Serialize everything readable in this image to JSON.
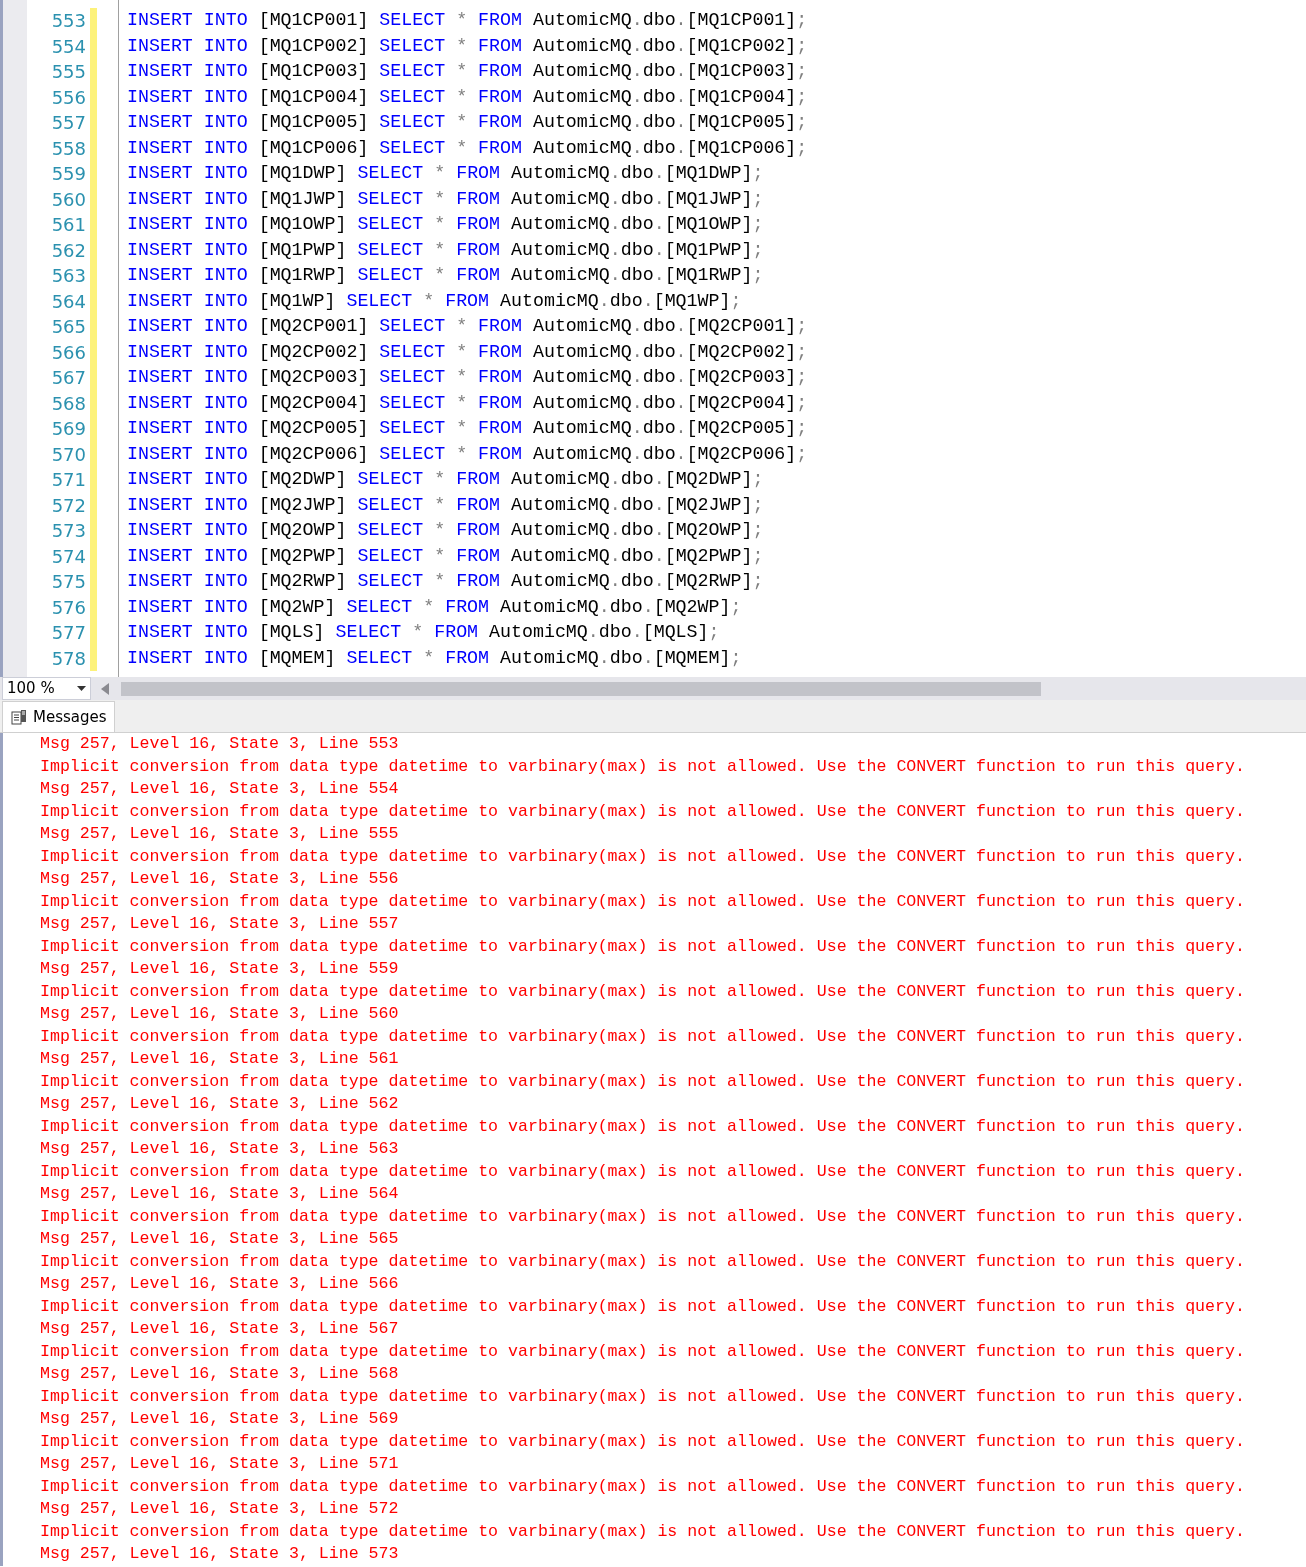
{
  "editor": {
    "lines": [
      {
        "number": "553",
        "modified": true,
        "tokens": [
          {
            "kind": "keyword",
            "text": "INSERT INTO "
          },
          {
            "kind": "name",
            "text": "[MQ1CP001] "
          },
          {
            "kind": "keyword",
            "text": "SELECT "
          },
          {
            "kind": "operator",
            "text": "* "
          },
          {
            "kind": "keyword",
            "text": "FROM "
          },
          {
            "kind": "name",
            "text": "AutomicMQ"
          },
          {
            "kind": "operator",
            "text": "."
          },
          {
            "kind": "name",
            "text": "dbo"
          },
          {
            "kind": "operator",
            "text": "."
          },
          {
            "kind": "name",
            "text": "[MQ1CP001]"
          },
          {
            "kind": "operator",
            "text": ";"
          }
        ]
      },
      {
        "number": "554",
        "modified": true,
        "tokens": [
          {
            "kind": "keyword",
            "text": "INSERT INTO "
          },
          {
            "kind": "name",
            "text": "[MQ1CP002] "
          },
          {
            "kind": "keyword",
            "text": "SELECT "
          },
          {
            "kind": "operator",
            "text": "* "
          },
          {
            "kind": "keyword",
            "text": "FROM "
          },
          {
            "kind": "name",
            "text": "AutomicMQ"
          },
          {
            "kind": "operator",
            "text": "."
          },
          {
            "kind": "name",
            "text": "dbo"
          },
          {
            "kind": "operator",
            "text": "."
          },
          {
            "kind": "name",
            "text": "[MQ1CP002]"
          },
          {
            "kind": "operator",
            "text": ";"
          }
        ]
      },
      {
        "number": "555",
        "modified": true,
        "tokens": [
          {
            "kind": "keyword",
            "text": "INSERT INTO "
          },
          {
            "kind": "name",
            "text": "[MQ1CP003] "
          },
          {
            "kind": "keyword",
            "text": "SELECT "
          },
          {
            "kind": "operator",
            "text": "* "
          },
          {
            "kind": "keyword",
            "text": "FROM "
          },
          {
            "kind": "name",
            "text": "AutomicMQ"
          },
          {
            "kind": "operator",
            "text": "."
          },
          {
            "kind": "name",
            "text": "dbo"
          },
          {
            "kind": "operator",
            "text": "."
          },
          {
            "kind": "name",
            "text": "[MQ1CP003]"
          },
          {
            "kind": "operator",
            "text": ";"
          }
        ]
      },
      {
        "number": "556",
        "modified": true,
        "tokens": [
          {
            "kind": "keyword",
            "text": "INSERT INTO "
          },
          {
            "kind": "name",
            "text": "[MQ1CP004] "
          },
          {
            "kind": "keyword",
            "text": "SELECT "
          },
          {
            "kind": "operator",
            "text": "* "
          },
          {
            "kind": "keyword",
            "text": "FROM "
          },
          {
            "kind": "name",
            "text": "AutomicMQ"
          },
          {
            "kind": "operator",
            "text": "."
          },
          {
            "kind": "name",
            "text": "dbo"
          },
          {
            "kind": "operator",
            "text": "."
          },
          {
            "kind": "name",
            "text": "[MQ1CP004]"
          },
          {
            "kind": "operator",
            "text": ";"
          }
        ]
      },
      {
        "number": "557",
        "modified": true,
        "tokens": [
          {
            "kind": "keyword",
            "text": "INSERT INTO "
          },
          {
            "kind": "name",
            "text": "[MQ1CP005] "
          },
          {
            "kind": "keyword",
            "text": "SELECT "
          },
          {
            "kind": "operator",
            "text": "* "
          },
          {
            "kind": "keyword",
            "text": "FROM "
          },
          {
            "kind": "name",
            "text": "AutomicMQ"
          },
          {
            "kind": "operator",
            "text": "."
          },
          {
            "kind": "name",
            "text": "dbo"
          },
          {
            "kind": "operator",
            "text": "."
          },
          {
            "kind": "name",
            "text": "[MQ1CP005]"
          },
          {
            "kind": "operator",
            "text": ";"
          }
        ]
      },
      {
        "number": "558",
        "modified": true,
        "tokens": [
          {
            "kind": "keyword",
            "text": "INSERT INTO "
          },
          {
            "kind": "name",
            "text": "[MQ1CP006] "
          },
          {
            "kind": "keyword",
            "text": "SELECT "
          },
          {
            "kind": "operator",
            "text": "* "
          },
          {
            "kind": "keyword",
            "text": "FROM "
          },
          {
            "kind": "name",
            "text": "AutomicMQ"
          },
          {
            "kind": "operator",
            "text": "."
          },
          {
            "kind": "name",
            "text": "dbo"
          },
          {
            "kind": "operator",
            "text": "."
          },
          {
            "kind": "name",
            "text": "[MQ1CP006]"
          },
          {
            "kind": "operator",
            "text": ";"
          }
        ]
      },
      {
        "number": "559",
        "modified": true,
        "tokens": [
          {
            "kind": "keyword",
            "text": "INSERT INTO "
          },
          {
            "kind": "name",
            "text": "[MQ1DWP] "
          },
          {
            "kind": "keyword",
            "text": "SELECT "
          },
          {
            "kind": "operator",
            "text": "* "
          },
          {
            "kind": "keyword",
            "text": "FROM "
          },
          {
            "kind": "name",
            "text": "AutomicMQ"
          },
          {
            "kind": "operator",
            "text": "."
          },
          {
            "kind": "name",
            "text": "dbo"
          },
          {
            "kind": "operator",
            "text": "."
          },
          {
            "kind": "name",
            "text": "[MQ1DWP]"
          },
          {
            "kind": "operator",
            "text": ";"
          }
        ]
      },
      {
        "number": "560",
        "modified": true,
        "tokens": [
          {
            "kind": "keyword",
            "text": "INSERT INTO "
          },
          {
            "kind": "name",
            "text": "[MQ1JWP] "
          },
          {
            "kind": "keyword",
            "text": "SELECT "
          },
          {
            "kind": "operator",
            "text": "* "
          },
          {
            "kind": "keyword",
            "text": "FROM "
          },
          {
            "kind": "name",
            "text": "AutomicMQ"
          },
          {
            "kind": "operator",
            "text": "."
          },
          {
            "kind": "name",
            "text": "dbo"
          },
          {
            "kind": "operator",
            "text": "."
          },
          {
            "kind": "name",
            "text": "[MQ1JWP]"
          },
          {
            "kind": "operator",
            "text": ";"
          }
        ]
      },
      {
        "number": "561",
        "modified": true,
        "tokens": [
          {
            "kind": "keyword",
            "text": "INSERT INTO "
          },
          {
            "kind": "name",
            "text": "[MQ1OWP] "
          },
          {
            "kind": "keyword",
            "text": "SELECT "
          },
          {
            "kind": "operator",
            "text": "* "
          },
          {
            "kind": "keyword",
            "text": "FROM "
          },
          {
            "kind": "name",
            "text": "AutomicMQ"
          },
          {
            "kind": "operator",
            "text": "."
          },
          {
            "kind": "name",
            "text": "dbo"
          },
          {
            "kind": "operator",
            "text": "."
          },
          {
            "kind": "name",
            "text": "[MQ1OWP]"
          },
          {
            "kind": "operator",
            "text": ";"
          }
        ]
      },
      {
        "number": "562",
        "modified": true,
        "tokens": [
          {
            "kind": "keyword",
            "text": "INSERT INTO "
          },
          {
            "kind": "name",
            "text": "[MQ1PWP] "
          },
          {
            "kind": "keyword",
            "text": "SELECT "
          },
          {
            "kind": "operator",
            "text": "* "
          },
          {
            "kind": "keyword",
            "text": "FROM "
          },
          {
            "kind": "name",
            "text": "AutomicMQ"
          },
          {
            "kind": "operator",
            "text": "."
          },
          {
            "kind": "name",
            "text": "dbo"
          },
          {
            "kind": "operator",
            "text": "."
          },
          {
            "kind": "name",
            "text": "[MQ1PWP]"
          },
          {
            "kind": "operator",
            "text": ";"
          }
        ]
      },
      {
        "number": "563",
        "modified": true,
        "tokens": [
          {
            "kind": "keyword",
            "text": "INSERT INTO "
          },
          {
            "kind": "name",
            "text": "[MQ1RWP] "
          },
          {
            "kind": "keyword",
            "text": "SELECT "
          },
          {
            "kind": "operator",
            "text": "* "
          },
          {
            "kind": "keyword",
            "text": "FROM "
          },
          {
            "kind": "name",
            "text": "AutomicMQ"
          },
          {
            "kind": "operator",
            "text": "."
          },
          {
            "kind": "name",
            "text": "dbo"
          },
          {
            "kind": "operator",
            "text": "."
          },
          {
            "kind": "name",
            "text": "[MQ1RWP]"
          },
          {
            "kind": "operator",
            "text": ";"
          }
        ]
      },
      {
        "number": "564",
        "modified": true,
        "tokens": [
          {
            "kind": "keyword",
            "text": "INSERT INTO "
          },
          {
            "kind": "name",
            "text": "[MQ1WP] "
          },
          {
            "kind": "keyword",
            "text": "SELECT "
          },
          {
            "kind": "operator",
            "text": "* "
          },
          {
            "kind": "keyword",
            "text": "FROM "
          },
          {
            "kind": "name",
            "text": "AutomicMQ"
          },
          {
            "kind": "operator",
            "text": "."
          },
          {
            "kind": "name",
            "text": "dbo"
          },
          {
            "kind": "operator",
            "text": "."
          },
          {
            "kind": "name",
            "text": "[MQ1WP]"
          },
          {
            "kind": "operator",
            "text": ";"
          }
        ]
      },
      {
        "number": "565",
        "modified": true,
        "tokens": [
          {
            "kind": "keyword",
            "text": "INSERT INTO "
          },
          {
            "kind": "name",
            "text": "[MQ2CP001] "
          },
          {
            "kind": "keyword",
            "text": "SELECT "
          },
          {
            "kind": "operator",
            "text": "* "
          },
          {
            "kind": "keyword",
            "text": "FROM "
          },
          {
            "kind": "name",
            "text": "AutomicMQ"
          },
          {
            "kind": "operator",
            "text": "."
          },
          {
            "kind": "name",
            "text": "dbo"
          },
          {
            "kind": "operator",
            "text": "."
          },
          {
            "kind": "name",
            "text": "[MQ2CP001]"
          },
          {
            "kind": "operator",
            "text": ";"
          }
        ]
      },
      {
        "number": "566",
        "modified": true,
        "tokens": [
          {
            "kind": "keyword",
            "text": "INSERT INTO "
          },
          {
            "kind": "name",
            "text": "[MQ2CP002] "
          },
          {
            "kind": "keyword",
            "text": "SELECT "
          },
          {
            "kind": "operator",
            "text": "* "
          },
          {
            "kind": "keyword",
            "text": "FROM "
          },
          {
            "kind": "name",
            "text": "AutomicMQ"
          },
          {
            "kind": "operator",
            "text": "."
          },
          {
            "kind": "name",
            "text": "dbo"
          },
          {
            "kind": "operator",
            "text": "."
          },
          {
            "kind": "name",
            "text": "[MQ2CP002]"
          },
          {
            "kind": "operator",
            "text": ";"
          }
        ]
      },
      {
        "number": "567",
        "modified": true,
        "tokens": [
          {
            "kind": "keyword",
            "text": "INSERT INTO "
          },
          {
            "kind": "name",
            "text": "[MQ2CP003] "
          },
          {
            "kind": "keyword",
            "text": "SELECT "
          },
          {
            "kind": "operator",
            "text": "* "
          },
          {
            "kind": "keyword",
            "text": "FROM "
          },
          {
            "kind": "name",
            "text": "AutomicMQ"
          },
          {
            "kind": "operator",
            "text": "."
          },
          {
            "kind": "name",
            "text": "dbo"
          },
          {
            "kind": "operator",
            "text": "."
          },
          {
            "kind": "name",
            "text": "[MQ2CP003]"
          },
          {
            "kind": "operator",
            "text": ";"
          }
        ]
      },
      {
        "number": "568",
        "modified": true,
        "tokens": [
          {
            "kind": "keyword",
            "text": "INSERT INTO "
          },
          {
            "kind": "name",
            "text": "[MQ2CP004] "
          },
          {
            "kind": "keyword",
            "text": "SELECT "
          },
          {
            "kind": "operator",
            "text": "* "
          },
          {
            "kind": "keyword",
            "text": "FROM "
          },
          {
            "kind": "name",
            "text": "AutomicMQ"
          },
          {
            "kind": "operator",
            "text": "."
          },
          {
            "kind": "name",
            "text": "dbo"
          },
          {
            "kind": "operator",
            "text": "."
          },
          {
            "kind": "name",
            "text": "[MQ2CP004]"
          },
          {
            "kind": "operator",
            "text": ";"
          }
        ]
      },
      {
        "number": "569",
        "modified": true,
        "tokens": [
          {
            "kind": "keyword",
            "text": "INSERT INTO "
          },
          {
            "kind": "name",
            "text": "[MQ2CP005] "
          },
          {
            "kind": "keyword",
            "text": "SELECT "
          },
          {
            "kind": "operator",
            "text": "* "
          },
          {
            "kind": "keyword",
            "text": "FROM "
          },
          {
            "kind": "name",
            "text": "AutomicMQ"
          },
          {
            "kind": "operator",
            "text": "."
          },
          {
            "kind": "name",
            "text": "dbo"
          },
          {
            "kind": "operator",
            "text": "."
          },
          {
            "kind": "name",
            "text": "[MQ2CP005]"
          },
          {
            "kind": "operator",
            "text": ";"
          }
        ]
      },
      {
        "number": "570",
        "modified": true,
        "tokens": [
          {
            "kind": "keyword",
            "text": "INSERT INTO "
          },
          {
            "kind": "name",
            "text": "[MQ2CP006] "
          },
          {
            "kind": "keyword",
            "text": "SELECT "
          },
          {
            "kind": "operator",
            "text": "* "
          },
          {
            "kind": "keyword",
            "text": "FROM "
          },
          {
            "kind": "name",
            "text": "AutomicMQ"
          },
          {
            "kind": "operator",
            "text": "."
          },
          {
            "kind": "name",
            "text": "dbo"
          },
          {
            "kind": "operator",
            "text": "."
          },
          {
            "kind": "name",
            "text": "[MQ2CP006]"
          },
          {
            "kind": "operator",
            "text": ";"
          }
        ]
      },
      {
        "number": "571",
        "modified": true,
        "tokens": [
          {
            "kind": "keyword",
            "text": "INSERT INTO "
          },
          {
            "kind": "name",
            "text": "[MQ2DWP] "
          },
          {
            "kind": "keyword",
            "text": "SELECT "
          },
          {
            "kind": "operator",
            "text": "* "
          },
          {
            "kind": "keyword",
            "text": "FROM "
          },
          {
            "kind": "name",
            "text": "AutomicMQ"
          },
          {
            "kind": "operator",
            "text": "."
          },
          {
            "kind": "name",
            "text": "dbo"
          },
          {
            "kind": "operator",
            "text": "."
          },
          {
            "kind": "name",
            "text": "[MQ2DWP]"
          },
          {
            "kind": "operator",
            "text": ";"
          }
        ]
      },
      {
        "number": "572",
        "modified": true,
        "tokens": [
          {
            "kind": "keyword",
            "text": "INSERT INTO "
          },
          {
            "kind": "name",
            "text": "[MQ2JWP] "
          },
          {
            "kind": "keyword",
            "text": "SELECT "
          },
          {
            "kind": "operator",
            "text": "* "
          },
          {
            "kind": "keyword",
            "text": "FROM "
          },
          {
            "kind": "name",
            "text": "AutomicMQ"
          },
          {
            "kind": "operator",
            "text": "."
          },
          {
            "kind": "name",
            "text": "dbo"
          },
          {
            "kind": "operator",
            "text": "."
          },
          {
            "kind": "name",
            "text": "[MQ2JWP]"
          },
          {
            "kind": "operator",
            "text": ";"
          }
        ]
      },
      {
        "number": "573",
        "modified": true,
        "tokens": [
          {
            "kind": "keyword",
            "text": "INSERT INTO "
          },
          {
            "kind": "name",
            "text": "[MQ2OWP] "
          },
          {
            "kind": "keyword",
            "text": "SELECT "
          },
          {
            "kind": "operator",
            "text": "* "
          },
          {
            "kind": "keyword",
            "text": "FROM "
          },
          {
            "kind": "name",
            "text": "AutomicMQ"
          },
          {
            "kind": "operator",
            "text": "."
          },
          {
            "kind": "name",
            "text": "dbo"
          },
          {
            "kind": "operator",
            "text": "."
          },
          {
            "kind": "name",
            "text": "[MQ2OWP]"
          },
          {
            "kind": "operator",
            "text": ";"
          }
        ]
      },
      {
        "number": "574",
        "modified": true,
        "tokens": [
          {
            "kind": "keyword",
            "text": "INSERT INTO "
          },
          {
            "kind": "name",
            "text": "[MQ2PWP] "
          },
          {
            "kind": "keyword",
            "text": "SELECT "
          },
          {
            "kind": "operator",
            "text": "* "
          },
          {
            "kind": "keyword",
            "text": "FROM "
          },
          {
            "kind": "name",
            "text": "AutomicMQ"
          },
          {
            "kind": "operator",
            "text": "."
          },
          {
            "kind": "name",
            "text": "dbo"
          },
          {
            "kind": "operator",
            "text": "."
          },
          {
            "kind": "name",
            "text": "[MQ2PWP]"
          },
          {
            "kind": "operator",
            "text": ";"
          }
        ]
      },
      {
        "number": "575",
        "modified": true,
        "tokens": [
          {
            "kind": "keyword",
            "text": "INSERT INTO "
          },
          {
            "kind": "name",
            "text": "[MQ2RWP] "
          },
          {
            "kind": "keyword",
            "text": "SELECT "
          },
          {
            "kind": "operator",
            "text": "* "
          },
          {
            "kind": "keyword",
            "text": "FROM "
          },
          {
            "kind": "name",
            "text": "AutomicMQ"
          },
          {
            "kind": "operator",
            "text": "."
          },
          {
            "kind": "name",
            "text": "dbo"
          },
          {
            "kind": "operator",
            "text": "."
          },
          {
            "kind": "name",
            "text": "[MQ2RWP]"
          },
          {
            "kind": "operator",
            "text": ";"
          }
        ]
      },
      {
        "number": "576",
        "modified": true,
        "tokens": [
          {
            "kind": "keyword",
            "text": "INSERT INTO "
          },
          {
            "kind": "name",
            "text": "[MQ2WP] "
          },
          {
            "kind": "keyword",
            "text": "SELECT "
          },
          {
            "kind": "operator",
            "text": "* "
          },
          {
            "kind": "keyword",
            "text": "FROM "
          },
          {
            "kind": "name",
            "text": "AutomicMQ"
          },
          {
            "kind": "operator",
            "text": "."
          },
          {
            "kind": "name",
            "text": "dbo"
          },
          {
            "kind": "operator",
            "text": "."
          },
          {
            "kind": "name",
            "text": "[MQ2WP]"
          },
          {
            "kind": "operator",
            "text": ";"
          }
        ]
      },
      {
        "number": "577",
        "modified": true,
        "tokens": [
          {
            "kind": "keyword",
            "text": "INSERT INTO "
          },
          {
            "kind": "name",
            "text": "[MQLS] "
          },
          {
            "kind": "keyword",
            "text": "SELECT "
          },
          {
            "kind": "operator",
            "text": "* "
          },
          {
            "kind": "keyword",
            "text": "FROM "
          },
          {
            "kind": "name",
            "text": "AutomicMQ"
          },
          {
            "kind": "operator",
            "text": "."
          },
          {
            "kind": "name",
            "text": "dbo"
          },
          {
            "kind": "operator",
            "text": "."
          },
          {
            "kind": "name",
            "text": "[MQLS]"
          },
          {
            "kind": "operator",
            "text": ";"
          }
        ]
      },
      {
        "number": "578",
        "modified": true,
        "tokens": [
          {
            "kind": "keyword",
            "text": "INSERT INTO "
          },
          {
            "kind": "name",
            "text": "[MQMEM] "
          },
          {
            "kind": "keyword",
            "text": "SELECT "
          },
          {
            "kind": "operator",
            "text": "* "
          },
          {
            "kind": "keyword",
            "text": "FROM "
          },
          {
            "kind": "name",
            "text": "AutomicMQ"
          },
          {
            "kind": "operator",
            "text": "."
          },
          {
            "kind": "name",
            "text": "dbo"
          },
          {
            "kind": "operator",
            "text": "."
          },
          {
            "kind": "name",
            "text": "[MQMEM]"
          },
          {
            "kind": "operator",
            "text": ";"
          }
        ]
      }
    ]
  },
  "zoom": {
    "value": "100 %"
  },
  "result_tabs": [
    {
      "label": "Messages",
      "selected": true
    }
  ],
  "messages": [
    "Msg 257, Level 16, State 3, Line 553",
    "Implicit conversion from data type datetime to varbinary(max) is not allowed. Use the CONVERT function to run this query.",
    "Msg 257, Level 16, State 3, Line 554",
    "Implicit conversion from data type datetime to varbinary(max) is not allowed. Use the CONVERT function to run this query.",
    "Msg 257, Level 16, State 3, Line 555",
    "Implicit conversion from data type datetime to varbinary(max) is not allowed. Use the CONVERT function to run this query.",
    "Msg 257, Level 16, State 3, Line 556",
    "Implicit conversion from data type datetime to varbinary(max) is not allowed. Use the CONVERT function to run this query.",
    "Msg 257, Level 16, State 3, Line 557",
    "Implicit conversion from data type datetime to varbinary(max) is not allowed. Use the CONVERT function to run this query.",
    "Msg 257, Level 16, State 3, Line 559",
    "Implicit conversion from data type datetime to varbinary(max) is not allowed. Use the CONVERT function to run this query.",
    "Msg 257, Level 16, State 3, Line 560",
    "Implicit conversion from data type datetime to varbinary(max) is not allowed. Use the CONVERT function to run this query.",
    "Msg 257, Level 16, State 3, Line 561",
    "Implicit conversion from data type datetime to varbinary(max) is not allowed. Use the CONVERT function to run this query.",
    "Msg 257, Level 16, State 3, Line 562",
    "Implicit conversion from data type datetime to varbinary(max) is not allowed. Use the CONVERT function to run this query.",
    "Msg 257, Level 16, State 3, Line 563",
    "Implicit conversion from data type datetime to varbinary(max) is not allowed. Use the CONVERT function to run this query.",
    "Msg 257, Level 16, State 3, Line 564",
    "Implicit conversion from data type datetime to varbinary(max) is not allowed. Use the CONVERT function to run this query.",
    "Msg 257, Level 16, State 3, Line 565",
    "Implicit conversion from data type datetime to varbinary(max) is not allowed. Use the CONVERT function to run this query.",
    "Msg 257, Level 16, State 3, Line 566",
    "Implicit conversion from data type datetime to varbinary(max) is not allowed. Use the CONVERT function to run this query.",
    "Msg 257, Level 16, State 3, Line 567",
    "Implicit conversion from data type datetime to varbinary(max) is not allowed. Use the CONVERT function to run this query.",
    "Msg 257, Level 16, State 3, Line 568",
    "Implicit conversion from data type datetime to varbinary(max) is not allowed. Use the CONVERT function to run this query.",
    "Msg 257, Level 16, State 3, Line 569",
    "Implicit conversion from data type datetime to varbinary(max) is not allowed. Use the CONVERT function to run this query.",
    "Msg 257, Level 16, State 3, Line 571",
    "Implicit conversion from data type datetime to varbinary(max) is not allowed. Use the CONVERT function to run this query.",
    "Msg 257, Level 16, State 3, Line 572",
    "Implicit conversion from data type datetime to varbinary(max) is not allowed. Use the CONVERT function to run this query.",
    "Msg 257, Level 16, State 3, Line 573"
  ]
}
